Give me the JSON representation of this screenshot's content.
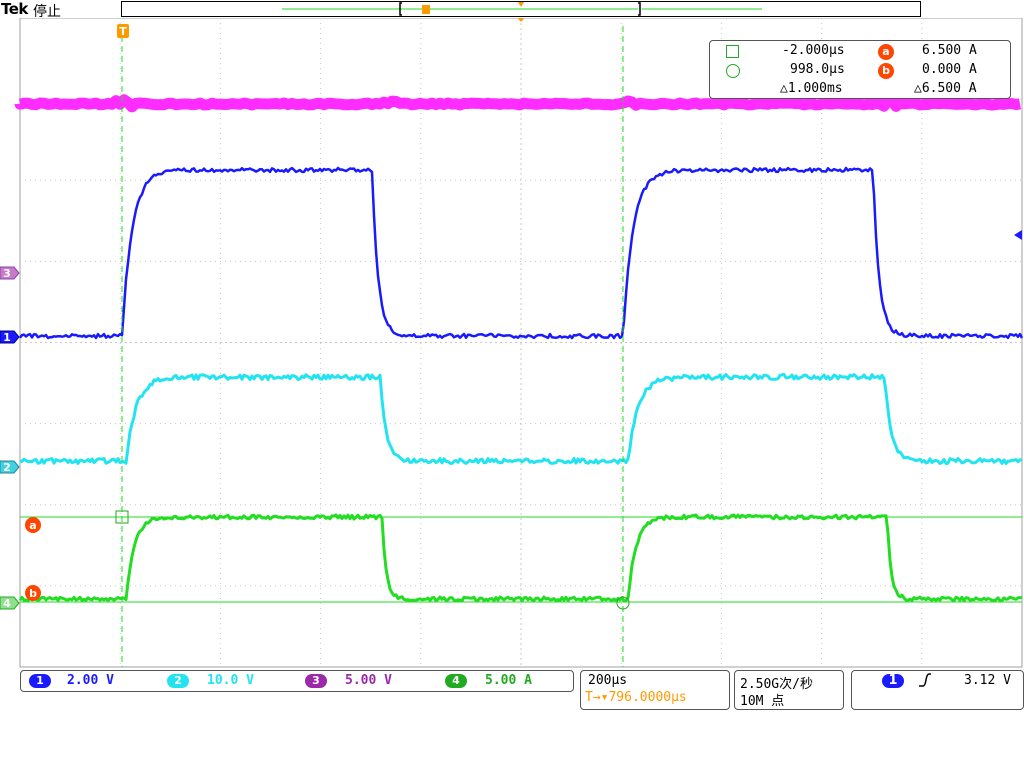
{
  "header": {
    "brand": "Tek",
    "run_state": "停止"
  },
  "colors": {
    "ch1": "#1a1aff",
    "ch2": "#22e4f0",
    "ch3": "#ff2cff",
    "ch4": "#22dd22",
    "grid": "#b0b0b0",
    "cursor": "#ff4500",
    "trigger": "#ff9900"
  },
  "cursor_readout": {
    "cursor1_time": "-2.000µs",
    "cursor2_time": "998.0µs",
    "delta_time": "△1.000ms",
    "cursor_a_value": "6.500 A",
    "cursor_b_value": "0.000 A",
    "delta_value": "△6.500 A",
    "cursor_a_label": "a",
    "cursor_b_label": "b",
    "cursor1_icon": "square-icon",
    "cursor2_icon": "circle-icon"
  },
  "channels": [
    {
      "number": "1",
      "scale": "2.00 V"
    },
    {
      "number": "2",
      "scale": "10.0 V"
    },
    {
      "number": "3",
      "scale": "5.00 V"
    },
    {
      "number": "4",
      "scale": "5.00 A"
    }
  ],
  "timebase": {
    "per_div": "200µs",
    "trigger_position": "T→▾796.0000µs"
  },
  "acquisition": {
    "sample_rate": "2.50G次/秒",
    "record_length": "10M 点"
  },
  "trigger": {
    "source": "1",
    "slope_icon": "rising-edge-icon",
    "level": "3.12 V",
    "marker_label": "T"
  },
  "markers": {
    "ch1": "1",
    "ch2": "2",
    "ch3": "3",
    "ch4": "4"
  }
}
